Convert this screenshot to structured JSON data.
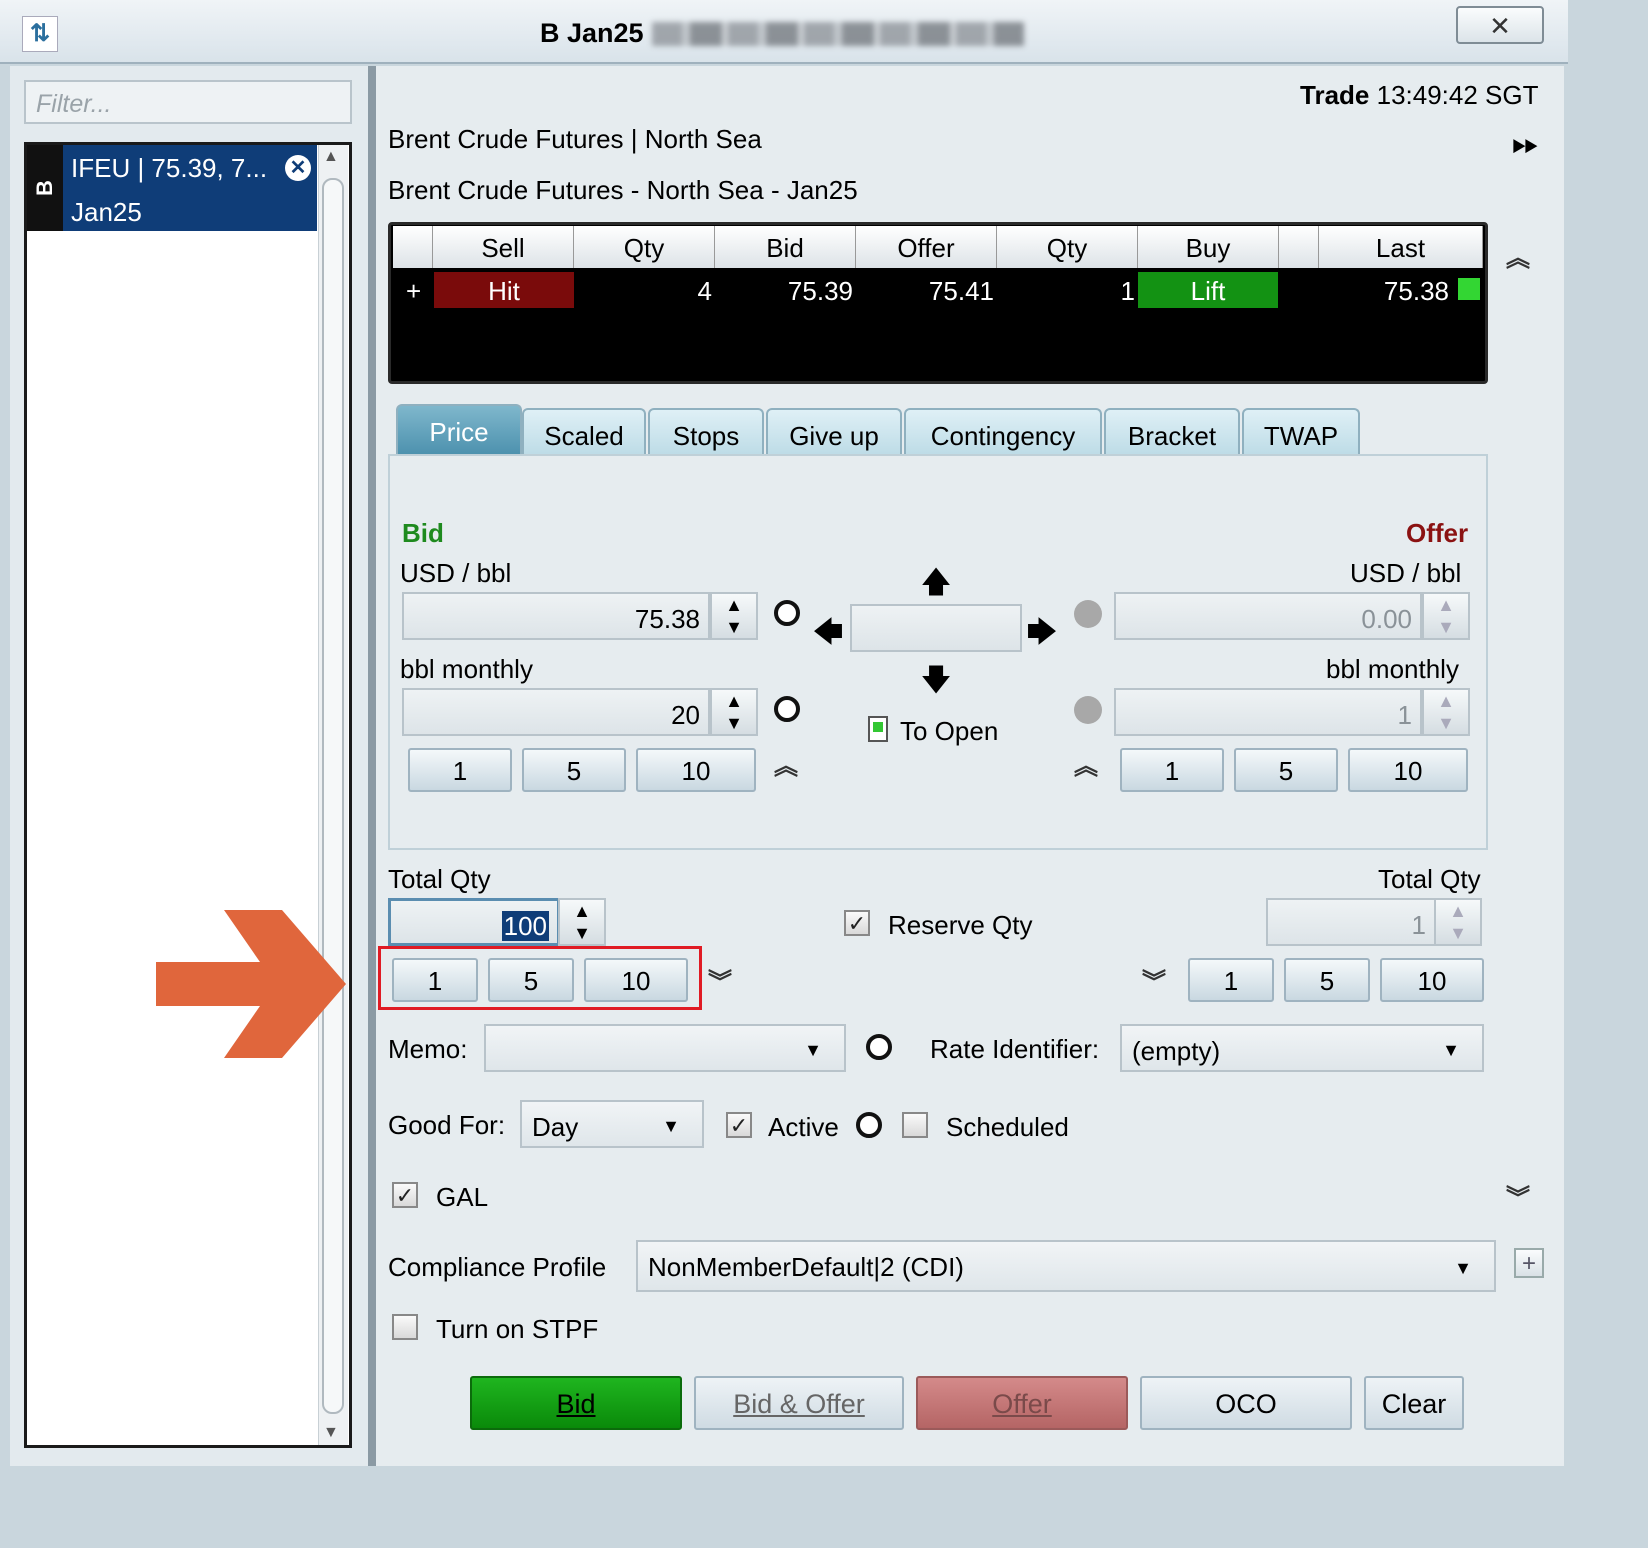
{
  "window": {
    "title": "B Jan25",
    "close_glyph": "✕"
  },
  "sidebar": {
    "filter_placeholder": "Filter...",
    "item_tab": "B",
    "item_line1": "IFEU | 75.39, 7...",
    "item_line2": "Jan25"
  },
  "header": {
    "trade_label": "Trade",
    "trade_time": "13:49:42 SGT",
    "instrument": "Brent Crude Futures | North Sea",
    "contract": "Brent Crude Futures - North Sea - Jan25"
  },
  "quote_table": {
    "columns": [
      "Sell",
      "Qty",
      "Bid",
      "Offer",
      "Qty",
      "Buy",
      "Last"
    ],
    "row": {
      "expand": "+",
      "sell": "Hit",
      "bid_qty": "4",
      "bid": "75.39",
      "offer": "75.41",
      "offer_qty": "1",
      "buy": "Lift",
      "last": "75.38"
    }
  },
  "tabs": [
    "Price",
    "Scaled",
    "Stops",
    "Give up",
    "Contingency",
    "Bracket",
    "TWAP"
  ],
  "price": {
    "bid_title": "Bid",
    "offer_title": "Offer",
    "unit_label": "USD / bbl",
    "qty_label": "bbl monthly",
    "bid_price": "75.38",
    "bid_qty": "20",
    "offer_price": "0.00",
    "offer_qty": "1",
    "quick": [
      "1",
      "5",
      "10"
    ],
    "to_open": "To Open"
  },
  "total": {
    "label": "Total Qty",
    "bid_value": "100",
    "offer_value": "1",
    "quick": [
      "1",
      "5",
      "10"
    ],
    "reserve": "Reserve Qty"
  },
  "memo": {
    "label": "Memo:",
    "value": ""
  },
  "rate": {
    "label": "Rate Identifier:",
    "value": "(empty)"
  },
  "good_for": {
    "label": "Good For:",
    "value": "Day",
    "active": "Active",
    "scheduled": "Scheduled"
  },
  "gal": "GAL",
  "compliance": {
    "label": "Compliance Profile",
    "value": "NonMemberDefault|2 (CDI)"
  },
  "stpf": "Turn on STPF",
  "actions": {
    "bid": "Bid",
    "bid_offer": "Bid & Offer",
    "offer": "Offer",
    "oco": "OCO",
    "clear": "Clear"
  },
  "colors": {
    "bid_green": "#1e8a1e",
    "offer_red": "#8b1212",
    "hit": "#7a0b0b",
    "lift": "#139213",
    "annotation": "#e0663c"
  }
}
